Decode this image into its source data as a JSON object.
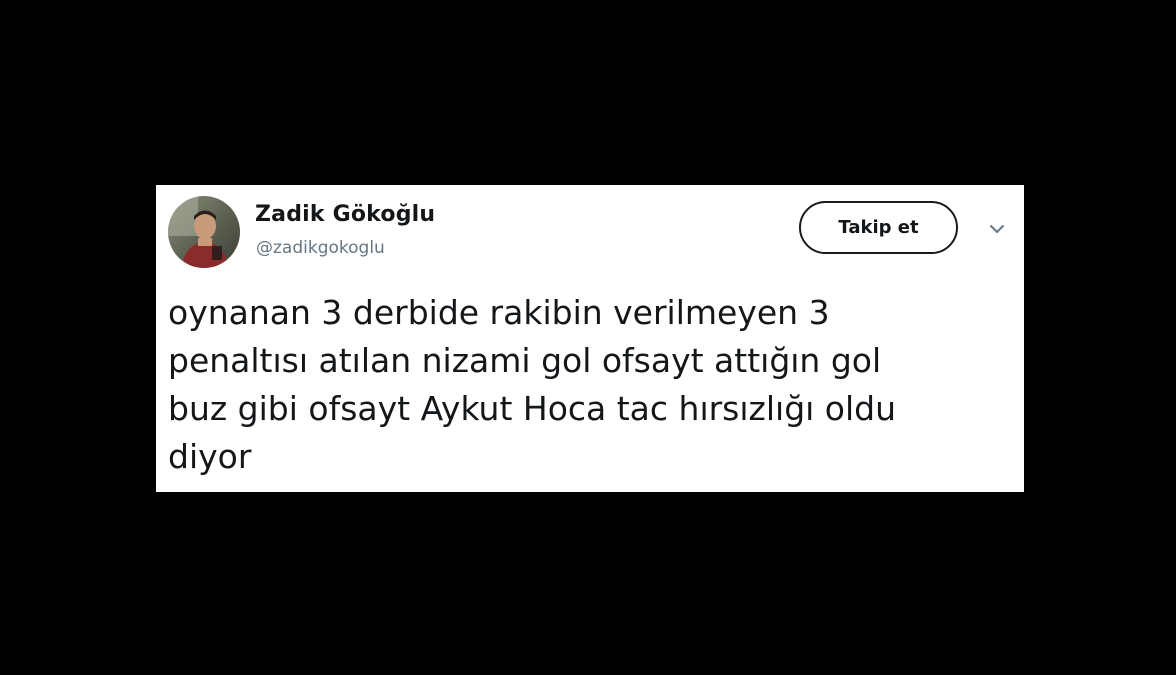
{
  "tweet": {
    "author": {
      "display_name": "Zadik Gökoğlu",
      "handle": "@zadikgokoglu",
      "avatar_icon": "profile-photo"
    },
    "follow_label": "Takip et",
    "menu_icon": "chevron-down-icon",
    "text_lines": [
      "oynanan 3 derbide rakibin verilmeyen 3",
      "penaltısı atılan nizami gol ofsayt attığın gol",
      "buz gibi ofsayt Aykut Hoca tac hırsızlığı oldu",
      "diyor"
    ]
  },
  "colors": {
    "background": "#000000",
    "card": "#ffffff",
    "text_primary": "#14171a",
    "text_secondary": "#657786"
  }
}
